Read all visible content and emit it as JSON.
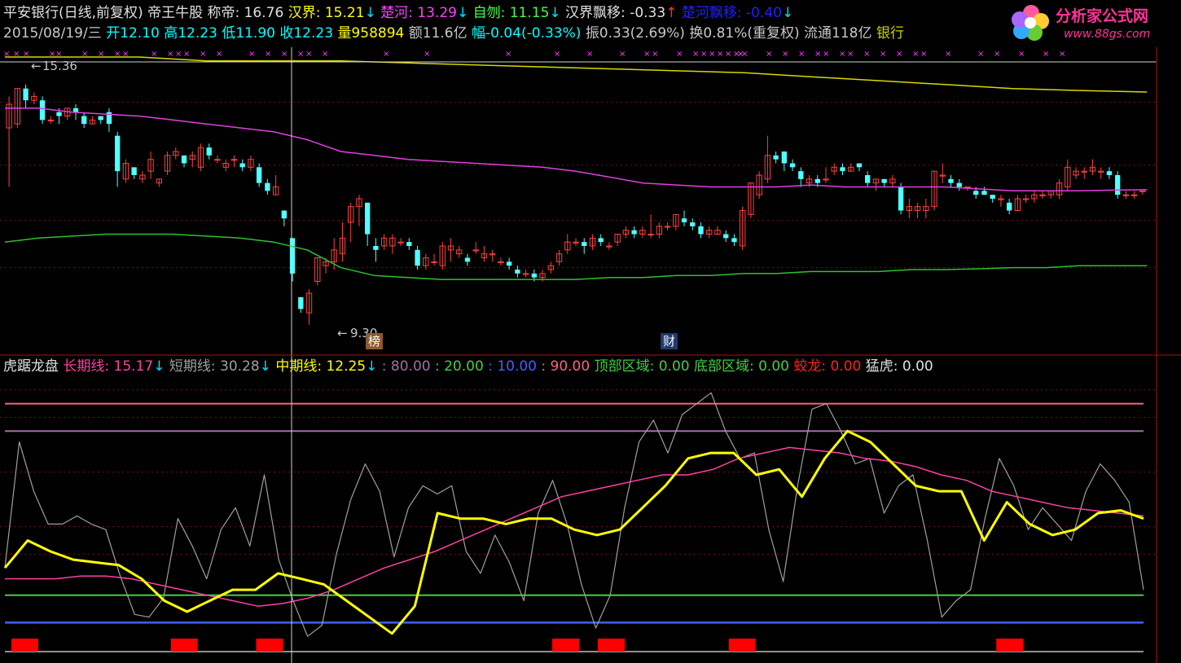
{
  "header": {
    "line1": [
      {
        "text": "平安银行(日线,前复权)",
        "color": "#e0e0e0"
      },
      {
        "text": " 帝王牛股 ",
        "color": "#e0e0e0"
      },
      {
        "text": "称帝: 16.76",
        "color": "#e0e0e0"
      },
      {
        "text": " 汉界: 15.21",
        "color": "#ffff00"
      },
      {
        "text": "↓",
        "color": "#00e0ff"
      },
      {
        "text": " 楚河: 13.29",
        "color": "#ff40ff"
      },
      {
        "text": "↓",
        "color": "#00e0ff"
      },
      {
        "text": " 自刎: 11.15",
        "color": "#40ff40"
      },
      {
        "text": "↓",
        "color": "#00e0ff"
      },
      {
        "text": " 汉界飘移: -0.33",
        "color": "#e0e0e0"
      },
      {
        "text": "↑",
        "color": "#ff3030"
      },
      {
        "text": " 楚河飘移: -0.40",
        "color": "#2020ff"
      },
      {
        "text": "↓",
        "color": "#00e0ff"
      }
    ],
    "line2": [
      {
        "text": "2015/08/19/三 ",
        "color": "#c8c8c8"
      },
      {
        "text": "开12.10 ",
        "color": "#00ffff"
      },
      {
        "text": "高12.23 ",
        "color": "#00ffff"
      },
      {
        "text": "低11.90 ",
        "color": "#00ffff"
      },
      {
        "text": "收12.23 ",
        "color": "#00ffff"
      },
      {
        "text": "量958894 ",
        "color": "#ffff00"
      },
      {
        "text": "额11.6亿 ",
        "color": "#c8c8c8"
      },
      {
        "text": "幅-0.04(-0.33%) ",
        "color": "#00ffff"
      },
      {
        "text": "振0.33(2.69%) ",
        "color": "#c8c8c8"
      },
      {
        "text": "换0.81%(重复权) ",
        "color": "#c8c8c8"
      },
      {
        "text": "流通118亿 ",
        "color": "#c8c8c8"
      },
      {
        "text": "银行",
        "color": "#d0d000"
      }
    ],
    "line3": [
      {
        "text": "虎踞龙盘  ",
        "color": "#e0e0e0"
      },
      {
        "text": "长期线: 15.17",
        "color": "#ff40a0"
      },
      {
        "text": "↓",
        "color": "#00e0ff"
      },
      {
        "text": "  短期线: 30.28",
        "color": "#a0a0a0"
      },
      {
        "text": "↓",
        "color": "#00e0ff"
      },
      {
        "text": "  中期线: 12.25",
        "color": "#ffff00"
      },
      {
        "text": "↓",
        "color": "#00e0ff"
      },
      {
        "text": "  : 80.00",
        "color": "#a070a0"
      },
      {
        "text": "  : 20.00",
        "color": "#40d040"
      },
      {
        "text": "  : 10.00",
        "color": "#4060ff"
      },
      {
        "text": "  : 90.00",
        "color": "#ff6080"
      },
      {
        "text": "  顶部区域: 0.00",
        "color": "#40d040"
      },
      {
        "text": "  底部区域: 0.00",
        "color": "#40d040"
      },
      {
        "text": "  蛟龙: 0.00",
        "color": "#ff2020"
      },
      {
        "text": "  猛虎: 0.00",
        "color": "#e0e0e0"
      }
    ]
  },
  "logo": {
    "text": "分析家公式网",
    "url_text": "www.88gs.com"
  },
  "annotations": {
    "high_label": "15.36",
    "low_label": "9.30",
    "tag_bang": "榜",
    "tag_cai": "财"
  },
  "chart_data": [
    {
      "type": "candlestick",
      "panel": "price",
      "ylim": [
        8.9,
        16.1
      ],
      "candles": [
        [
          14.3,
          14.9,
          15.1,
          12.8
        ],
        [
          14.4,
          15.3,
          15.3,
          14.3
        ],
        [
          15.3,
          15.0,
          15.4,
          14.8
        ],
        [
          15.0,
          15.1,
          15.2,
          14.9
        ],
        [
          15.0,
          14.5,
          15.1,
          14.4
        ],
        [
          14.5,
          14.5,
          14.6,
          14.4
        ],
        [
          14.7,
          14.6,
          14.8,
          14.4
        ],
        [
          14.6,
          14.8,
          14.8,
          14.5
        ],
        [
          14.8,
          14.7,
          14.9,
          14.5
        ],
        [
          14.6,
          14.4,
          14.7,
          14.3
        ],
        [
          14.4,
          14.5,
          14.6,
          14.4
        ],
        [
          14.6,
          14.5,
          14.6,
          14.4
        ],
        [
          14.7,
          14.4,
          14.8,
          14.2
        ],
        [
          14.1,
          13.2,
          14.2,
          12.8
        ],
        [
          13.0,
          13.4,
          13.5,
          12.9
        ],
        [
          13.3,
          13.1,
          13.3,
          13.0
        ],
        [
          13.0,
          13.1,
          13.2,
          12.9
        ],
        [
          13.2,
          13.5,
          13.7,
          13.0
        ],
        [
          12.9,
          13.0,
          13.0,
          12.8
        ],
        [
          13.2,
          13.6,
          13.7,
          13.1
        ],
        [
          13.6,
          13.7,
          13.8,
          13.5
        ],
        [
          13.6,
          13.4,
          13.6,
          13.3
        ],
        [
          13.5,
          13.6,
          13.7,
          13.3
        ],
        [
          13.3,
          13.8,
          13.9,
          13.2
        ],
        [
          13.8,
          13.6,
          13.9,
          13.5
        ],
        [
          13.5,
          13.5,
          13.6,
          13.4
        ],
        [
          13.3,
          13.4,
          13.5,
          13.2
        ],
        [
          13.5,
          13.5,
          13.6,
          13.3
        ],
        [
          13.4,
          13.3,
          13.5,
          13.2
        ],
        [
          13.3,
          13.5,
          13.6,
          13.2
        ],
        [
          13.3,
          12.9,
          13.4,
          12.8
        ],
        [
          12.9,
          12.7,
          13.0,
          12.6
        ],
        [
          12.6,
          12.8,
          13.1,
          12.6
        ],
        [
          12.2,
          12.0,
          12.2,
          11.8
        ],
        [
          11.5,
          10.6,
          11.5,
          10.4
        ],
        [
          10.0,
          9.7,
          10.0,
          9.6
        ],
        [
          9.6,
          10.1,
          10.2,
          9.3
        ],
        [
          10.4,
          11.0,
          11.0,
          10.3
        ],
        [
          10.8,
          10.9,
          11.0,
          10.6
        ],
        [
          10.9,
          11.2,
          11.5,
          10.7
        ],
        [
          11.1,
          11.5,
          11.9,
          10.9
        ],
        [
          11.9,
          12.3,
          12.4,
          11.4
        ],
        [
          12.3,
          12.5,
          12.6,
          11.8
        ],
        [
          12.4,
          11.6,
          12.4,
          11.3
        ],
        [
          11.3,
          11.2,
          11.5,
          10.9
        ],
        [
          11.3,
          11.5,
          11.6,
          11.2
        ],
        [
          11.3,
          11.5,
          11.6,
          11.1
        ],
        [
          11.4,
          11.4,
          11.5,
          11.3
        ],
        [
          11.4,
          11.3,
          11.5,
          11.2
        ],
        [
          11.2,
          10.8,
          11.3,
          10.7
        ],
        [
          10.8,
          11.0,
          11.1,
          10.7
        ],
        [
          10.9,
          10.9,
          11.1,
          10.8
        ],
        [
          10.8,
          11.3,
          11.4,
          10.7
        ],
        [
          11.2,
          11.3,
          11.5,
          10.9
        ],
        [
          11.1,
          11.2,
          11.3,
          11.0
        ],
        [
          11.0,
          10.9,
          11.1,
          10.8
        ],
        [
          11.2,
          11.2,
          11.4,
          11.1
        ],
        [
          11.0,
          11.1,
          11.3,
          10.9
        ],
        [
          11.1,
          11.1,
          11.2,
          10.9
        ],
        [
          10.9,
          10.9,
          11.0,
          10.8
        ],
        [
          10.9,
          10.8,
          11.0,
          10.7
        ],
        [
          10.7,
          10.6,
          10.8,
          10.5
        ],
        [
          10.6,
          10.6,
          10.7,
          10.5
        ],
        [
          10.6,
          10.5,
          10.7,
          10.4
        ],
        [
          10.5,
          10.6,
          10.7,
          10.4
        ],
        [
          10.7,
          10.8,
          10.9,
          10.6
        ],
        [
          10.9,
          11.1,
          11.2,
          10.8
        ],
        [
          11.2,
          11.4,
          11.6,
          11.1
        ],
        [
          11.4,
          11.4,
          11.5,
          11.3
        ],
        [
          11.4,
          11.3,
          11.5,
          11.1
        ],
        [
          11.3,
          11.5,
          11.6,
          11.2
        ],
        [
          11.5,
          11.4,
          11.6,
          11.3
        ],
        [
          11.3,
          11.3,
          11.4,
          11.2
        ],
        [
          11.4,
          11.6,
          11.6,
          11.3
        ],
        [
          11.6,
          11.7,
          11.8,
          11.5
        ],
        [
          11.7,
          11.6,
          11.8,
          11.5
        ],
        [
          11.6,
          11.7,
          11.8,
          11.5
        ],
        [
          11.6,
          11.6,
          12.1,
          11.5
        ],
        [
          11.6,
          11.8,
          11.9,
          11.5
        ],
        [
          11.8,
          11.8,
          11.9,
          11.7
        ],
        [
          11.8,
          12.1,
          12.1,
          11.7
        ],
        [
          12.0,
          11.9,
          12.2,
          11.8
        ],
        [
          11.9,
          11.8,
          12.0,
          11.7
        ],
        [
          11.8,
          11.6,
          11.9,
          11.5
        ],
        [
          11.6,
          11.7,
          11.8,
          11.5
        ],
        [
          11.6,
          11.7,
          11.8,
          11.6
        ],
        [
          11.6,
          11.5,
          11.7,
          11.4
        ],
        [
          11.5,
          11.4,
          11.6,
          11.3
        ],
        [
          11.3,
          12.2,
          12.3,
          11.2
        ],
        [
          12.1,
          12.9,
          12.9,
          12.0
        ],
        [
          12.6,
          13.1,
          13.2,
          12.5
        ],
        [
          13.0,
          13.6,
          14.1,
          12.9
        ],
        [
          13.6,
          13.5,
          13.7,
          13.4
        ],
        [
          13.7,
          13.4,
          13.7,
          13.2
        ],
        [
          13.4,
          13.3,
          13.5,
          13.2
        ],
        [
          13.2,
          13.0,
          13.3,
          12.8
        ],
        [
          12.9,
          13.0,
          13.1,
          12.8
        ],
        [
          13.0,
          12.9,
          13.1,
          12.8
        ],
        [
          13.0,
          13.0,
          13.3,
          12.9
        ],
        [
          13.2,
          13.3,
          13.4,
          13.1
        ],
        [
          13.3,
          13.2,
          13.4,
          13.1
        ],
        [
          13.2,
          13.3,
          13.4,
          13.2
        ],
        [
          13.4,
          13.3,
          13.4,
          13.2
        ],
        [
          13.1,
          12.9,
          13.2,
          12.8
        ],
        [
          12.9,
          13.0,
          13.0,
          12.7
        ],
        [
          13.0,
          12.9,
          13.0,
          12.8
        ],
        [
          12.9,
          13.0,
          13.1,
          12.8
        ],
        [
          12.8,
          12.2,
          12.9,
          12.1
        ],
        [
          12.2,
          12.3,
          12.5,
          12.0
        ],
        [
          12.2,
          12.3,
          12.4,
          12.0
        ],
        [
          12.2,
          12.3,
          12.5,
          12.0
        ],
        [
          12.3,
          13.2,
          13.2,
          12.2
        ],
        [
          13.1,
          13.1,
          13.4,
          12.9
        ],
        [
          13.0,
          12.9,
          13.1,
          12.8
        ],
        [
          12.9,
          12.8,
          13.0,
          12.7
        ],
        [
          12.8,
          12.8,
          12.8,
          12.7
        ],
        [
          12.7,
          12.6,
          12.8,
          12.5
        ],
        [
          12.7,
          12.6,
          12.8,
          12.6
        ],
        [
          12.6,
          12.5,
          12.6,
          12.4
        ],
        [
          12.5,
          12.5,
          12.6,
          12.3
        ],
        [
          12.4,
          12.2,
          12.5,
          12.1
        ],
        [
          12.2,
          12.5,
          12.6,
          12.2
        ],
        [
          12.5,
          12.5,
          12.6,
          12.4
        ],
        [
          12.5,
          12.6,
          12.7,
          12.4
        ],
        [
          12.6,
          12.6,
          12.7,
          12.5
        ],
        [
          12.6,
          12.7,
          12.7,
          12.5
        ],
        [
          12.6,
          12.9,
          13.0,
          12.5
        ],
        [
          12.8,
          13.3,
          13.5,
          12.7
        ],
        [
          13.1,
          13.2,
          13.3,
          13.0
        ],
        [
          13.2,
          13.2,
          13.3,
          13.0
        ],
        [
          13.2,
          13.3,
          13.5,
          13.1
        ],
        [
          13.2,
          13.2,
          13.3,
          13.0
        ],
        [
          13.2,
          13.1,
          13.3,
          13.0
        ],
        [
          13.1,
          12.6,
          13.2,
          12.5
        ],
        [
          12.6,
          12.6,
          12.7,
          12.5
        ],
        [
          12.6,
          12.6,
          12.7,
          12.5
        ],
        [
          12.7,
          12.7,
          12.7,
          12.6
        ]
      ],
      "ma_yellow": [
        16.1,
        16.1,
        16.1,
        16.0,
        16.0,
        16.0,
        15.95,
        15.9,
        15.85,
        15.8,
        15.75,
        15.7,
        15.6,
        15.5,
        15.4,
        15.3,
        15.25,
        15.21
      ],
      "ma_magenta": [
        14.8,
        14.8,
        14.7,
        14.65,
        14.6,
        14.5,
        14.4,
        14.3,
        14.2,
        14.0,
        13.7,
        13.6,
        13.5,
        13.45,
        13.4,
        13.35,
        13.3,
        13.2,
        13.05,
        12.9,
        12.85,
        12.8,
        12.8,
        12.8,
        12.85,
        12.8,
        12.8,
        12.8,
        12.8,
        12.75,
        12.7,
        12.7,
        12.7,
        12.72,
        12.73
      ],
      "ma_green": [
        11.4,
        11.5,
        11.55,
        11.6,
        11.6,
        11.6,
        11.55,
        11.5,
        11.4,
        11.2,
        10.75,
        10.55,
        10.5,
        10.45,
        10.45,
        10.45,
        10.45,
        10.45,
        10.5,
        10.5,
        10.55,
        10.55,
        10.6,
        10.6,
        10.65,
        10.65,
        10.65,
        10.7,
        10.7,
        10.72,
        10.75,
        10.75,
        10.8,
        10.8,
        10.8
      ],
      "high": 15.36,
      "low": 9.3
    },
    {
      "type": "line",
      "panel": "indicator",
      "title": "虎踞龙盘",
      "ylim": [
        0,
        100
      ],
      "hlines": [
        {
          "y": 90,
          "color": "#ff6080"
        },
        {
          "y": 80,
          "color": "#a070a0"
        },
        {
          "y": 20,
          "color": "#40d040"
        },
        {
          "y": 10,
          "color": "#4060ff"
        }
      ],
      "series": [
        {
          "name": "短期线",
          "color": "#a0a0a0",
          "values": [
            30,
            76,
            58,
            46,
            46,
            49,
            46,
            44,
            27,
            13,
            12,
            19,
            48,
            38,
            26,
            44,
            52,
            38,
            64,
            33,
            18,
            5,
            9,
            35,
            55,
            68,
            58,
            34,
            52,
            60,
            57,
            60,
            36,
            28,
            42,
            32,
            18,
            50,
            62,
            46,
            24,
            8,
            20,
            52,
            76,
            84,
            72,
            86,
            90,
            94,
            80,
            70,
            72,
            44,
            25,
            60,
            88,
            90,
            80,
            68,
            70,
            50,
            60,
            64,
            40,
            12,
            18,
            22,
            48,
            70,
            60,
            44,
            52,
            46,
            40,
            58,
            68,
            62,
            54,
            22
          ]
        },
        {
          "name": "长期线",
          "color": "#ff40a0",
          "values": [
            26,
            26,
            26,
            27,
            27,
            26,
            24,
            22,
            20,
            18,
            16,
            17,
            19,
            22,
            26,
            30,
            33,
            36,
            40,
            44,
            48,
            52,
            56,
            58,
            60,
            62,
            64,
            64,
            66,
            70,
            72,
            74,
            73,
            72,
            70,
            69,
            67,
            64,
            62,
            58,
            56,
            54,
            52,
            51,
            50,
            49
          ]
        },
        {
          "name": "中期线",
          "color": "#ffff00",
          "values": [
            30,
            40,
            36,
            33,
            32,
            31,
            26,
            18,
            14,
            18,
            22,
            22,
            28,
            26,
            24,
            18,
            12,
            6,
            16,
            50,
            48,
            48,
            46,
            48,
            48,
            44,
            42,
            44,
            52,
            60,
            70,
            72,
            72,
            64,
            66,
            56,
            70,
            80,
            76,
            68,
            60,
            58,
            58,
            40,
            54,
            46,
            42,
            44,
            50,
            51,
            48
          ]
        }
      ],
      "signal_boxes": [
        0.01,
        0.15,
        0.225,
        0.485,
        0.525,
        0.64,
        0.875
      ]
    }
  ]
}
